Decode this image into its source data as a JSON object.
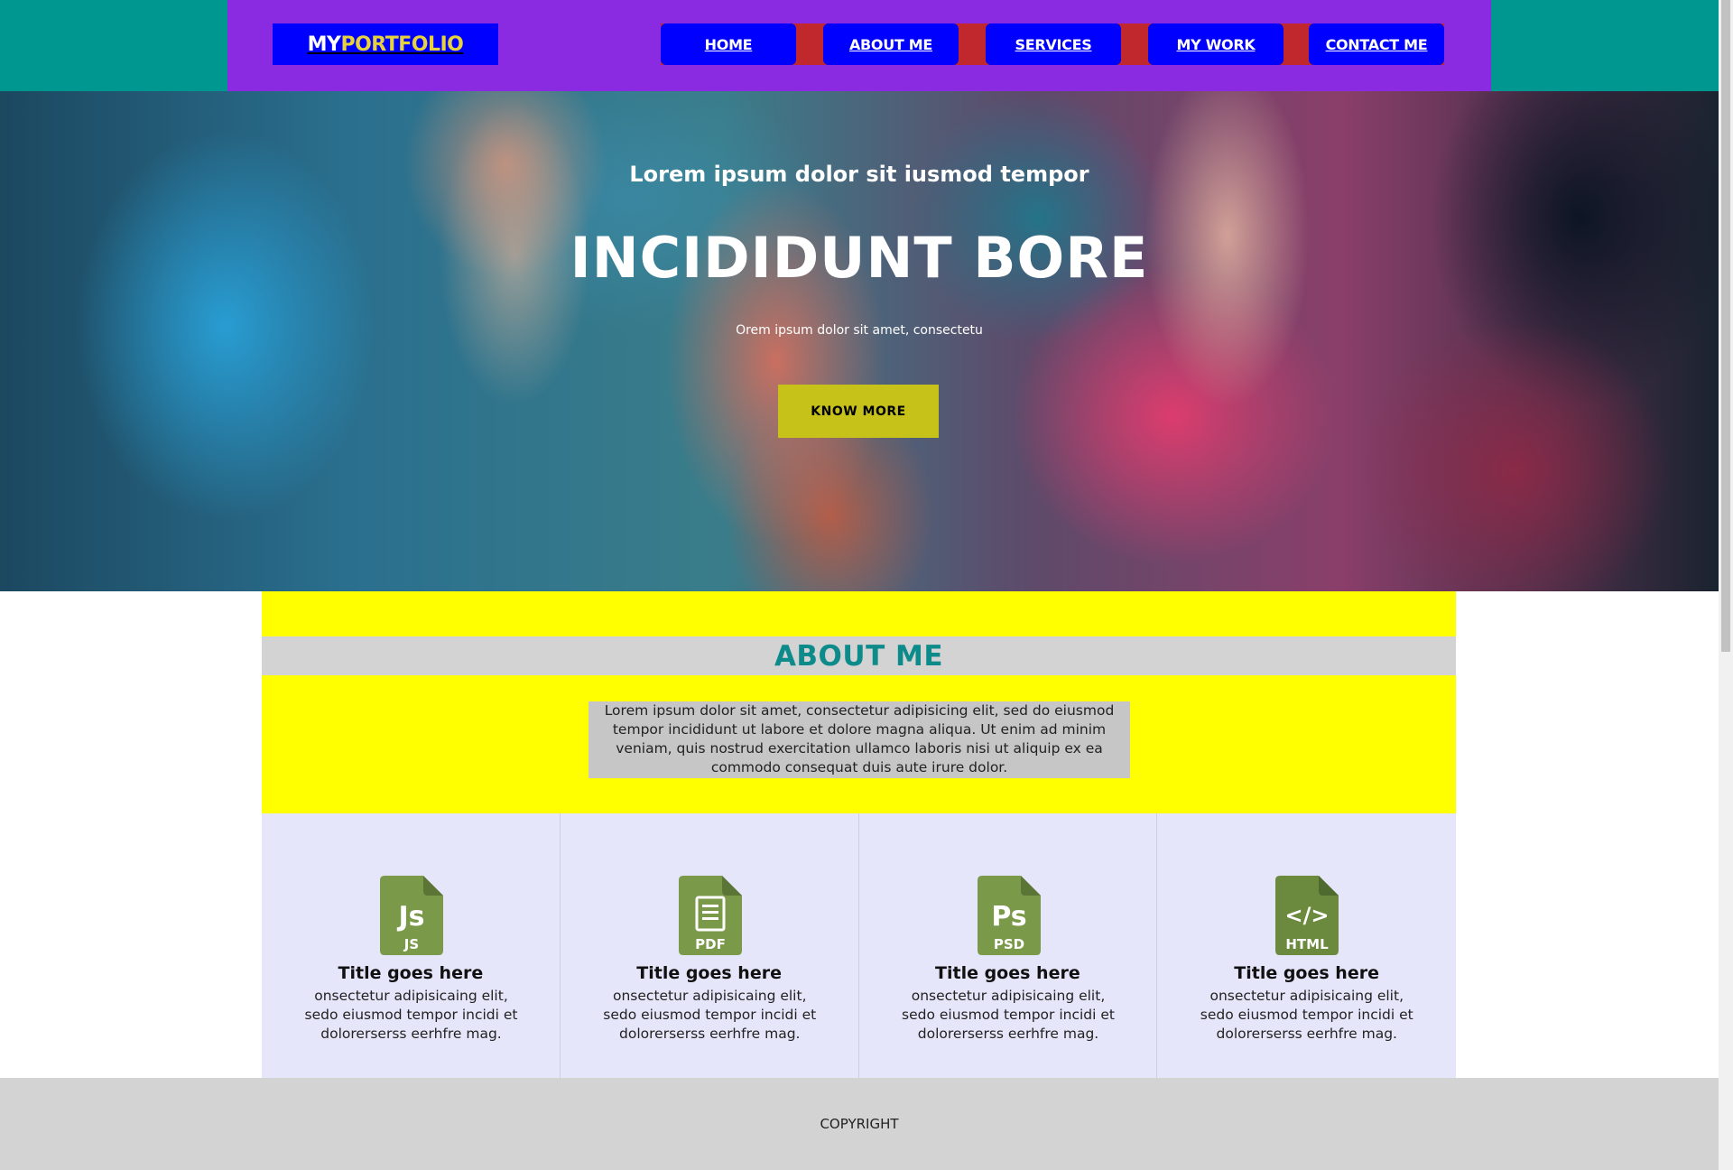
{
  "header": {
    "logo_prefix": "MY",
    "logo_suffix": "PORTFOLIO",
    "nav": [
      {
        "label": "HOME"
      },
      {
        "label": "ABOUT ME"
      },
      {
        "label": "SERVICES"
      },
      {
        "label": "MY WORK"
      },
      {
        "label": "CONTACT ME"
      }
    ]
  },
  "hero": {
    "subtitle": "Lorem ipsum dolor sit iusmod tempor",
    "title": "INCIDIDUNT BORE",
    "description": "Orem ipsum dolor sit amet, consectetu",
    "button_label": "KNOW MORE"
  },
  "about": {
    "heading": "ABOUT ME",
    "text": "Lorem ipsum dolor sit amet, consectetur adipisicing elit, sed do eiusmod tempor incididunt ut labore et dolore magna aliqua. Ut enim ad minim veniam, quis nostrud exercitation ullamco laboris nisi ut aliquip ex ea commodo consequat duis aute irure dolor."
  },
  "services": [
    {
      "icon": "js-file-icon",
      "badge": "JS",
      "glyph": "Js",
      "title": "Title goes here",
      "description": "onsectetur adipisicaing elit, sedo eiusmod tempor incidi et dolorerserss eerhfre mag."
    },
    {
      "icon": "pdf-file-icon",
      "badge": "PDF",
      "glyph": "",
      "title": "Title goes here",
      "description": "onsectetur adipisicaing elit, sedo eiusmod tempor incidi et dolorerserss eerhfre mag."
    },
    {
      "icon": "psd-file-icon",
      "badge": "PSD",
      "glyph": "Ps",
      "title": "Title goes here",
      "description": "onsectetur adipisicaing elit, sedo eiusmod tempor incidi et dolorerserss eerhfre mag."
    },
    {
      "icon": "html-file-icon",
      "badge": "HTML",
      "glyph": "</>",
      "title": "Title goes here",
      "description": "onsectetur adipisicaing elit, sedo eiusmod tempor incidi et dolorerserss eerhfre mag."
    }
  ],
  "footer": {
    "copyright": "COPYRIGHT"
  },
  "colors": {
    "header_bg": "#8a2be2",
    "top_bar_bg": "#009790",
    "nav_button_bg": "#0000ff",
    "nav_strip_bg": "#c0282d",
    "hero_button_bg": "#c6c21a",
    "about_band_bg": "#ffff00",
    "about_heading": "#0d8b8b",
    "services_bg": "#e6e6fa",
    "icon_green": "#7a9a4a",
    "footer_bg": "#d3d3d3"
  }
}
